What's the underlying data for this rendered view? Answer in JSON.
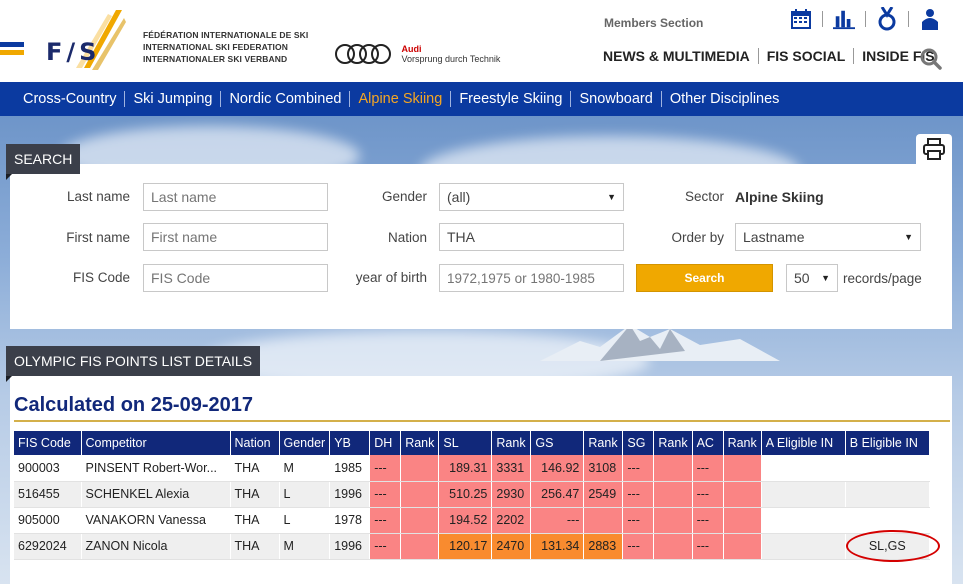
{
  "header": {
    "logo_letters": "F/S",
    "federation_names": [
      "FÉDÉRATION INTERNATIONALE DE SKI",
      "INTERNATIONAL SKI FEDERATION",
      "INTERNATIONALER SKI VERBAND"
    ],
    "sponsor_brand": "Audi",
    "sponsor_slogan": "Vorsprung durch Technik",
    "members_section": "Members Section",
    "top_nav": [
      "NEWS & MULTIMEDIA",
      "FIS SOCIAL",
      "INSIDE FIS"
    ],
    "icons": [
      "calendar-icon",
      "results-chart-icon",
      "medal-icon",
      "athlete-icon",
      "search-icon"
    ]
  },
  "disciplines": {
    "items": [
      "Cross-Country",
      "Ski Jumping",
      "Nordic Combined",
      "Alpine Skiing",
      "Freestyle Skiing",
      "Snowboard",
      "Other Disciplines"
    ],
    "active": "Alpine Skiing"
  },
  "search": {
    "title": "SEARCH",
    "last_name_label": "Last name",
    "last_name_placeholder": "Last name",
    "first_name_label": "First name",
    "first_name_placeholder": "First name",
    "fis_code_label": "FIS Code",
    "fis_code_placeholder": "FIS Code",
    "gender_label": "Gender",
    "gender_value": "(all)",
    "nation_label": "Nation",
    "nation_value": "THA",
    "yob_label": "year of birth",
    "yob_placeholder": "1972,1975 or 1980-1985",
    "sector_label": "Sector",
    "sector_value": "Alpine Skiing",
    "order_by_label": "Order by",
    "order_by_value": "Lastname",
    "search_button": "Search",
    "records_value": "50",
    "records_label": "records/page"
  },
  "results": {
    "title": "OLYMPIC FIS POINTS LIST DETAILS",
    "calculated": "Calculated on 25-09-2017",
    "columns": [
      "FIS Code",
      "Competitor",
      "Nation",
      "Gender",
      "YB",
      "DH",
      "Rank",
      "SL",
      "Rank",
      "GS",
      "Rank",
      "SG",
      "Rank",
      "AC",
      "Rank",
      "A Eligible IN",
      "B Eligible IN"
    ],
    "rows": [
      [
        "900003",
        "PINSENT Robert-Wor...",
        "THA",
        "M",
        "1985",
        "---",
        "",
        "189.31",
        "3331",
        "146.92",
        "3108",
        "---",
        "",
        "---",
        "",
        "",
        ""
      ],
      [
        "516455",
        "SCHENKEL Alexia",
        "THA",
        "L",
        "1996",
        "---",
        "",
        "510.25",
        "2930",
        "256.47",
        "2549",
        "---",
        "",
        "---",
        "",
        "",
        ""
      ],
      [
        "905000",
        "VANAKORN Vanessa",
        "THA",
        "L",
        "1978",
        "---",
        "",
        "194.52",
        "2202",
        "---",
        "",
        "---",
        "",
        "---",
        "",
        "",
        ""
      ],
      [
        "6292024",
        "ZANON Nicola",
        "THA",
        "M",
        "1996",
        "---",
        "",
        "120.17",
        "2470",
        "131.34",
        "2883",
        "---",
        "",
        "---",
        "",
        "",
        "SL,GS"
      ]
    ]
  },
  "colors": {
    "nav_blue": "#0b3aa0",
    "header_blue": "#11287a",
    "active_orange": "#f5a623",
    "cell_red": "#fa8484",
    "cell_orange": "#f98b2f",
    "button_gold": "#f0a800",
    "highlight_oval": "#d40000"
  }
}
